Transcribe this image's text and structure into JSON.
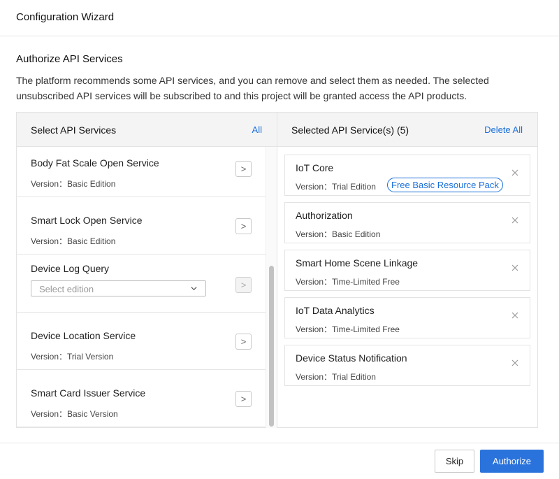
{
  "window": {
    "title": "Configuration Wizard"
  },
  "section": {
    "title": "Authorize API Services",
    "description": "The platform recommends some API services, and you can remove and select them as needed. The selected unsubscribed API services will be subscribed to and this project will be granted access the API products."
  },
  "left_panel": {
    "title": "Select API Services",
    "all_link": "All",
    "services": [
      {
        "name": "Body Fat Scale Open Service",
        "version": "Version：Basic Edition"
      },
      {
        "name": "Smart Lock Open Service",
        "version": "Version：Basic Edition"
      },
      {
        "name": "Device Log Query",
        "select_placeholder": "Select edition"
      },
      {
        "name": "Device Location Service",
        "version": "Version：Trial Version"
      },
      {
        "name": "Smart Card Issuer Service",
        "version": "Version：Basic Version"
      }
    ],
    "arrow_glyph": ">"
  },
  "right_panel": {
    "title": "Selected API Service(s) (5)",
    "delete_all": "Delete All",
    "items": [
      {
        "name": "IoT Core",
        "version": "Version：Trial Edition",
        "badge": "Free Basic Resource Pack"
      },
      {
        "name": "Authorization",
        "version": "Version：Basic Edition"
      },
      {
        "name": "Smart Home Scene Linkage",
        "version": "Version：Time-Limited Free"
      },
      {
        "name": "IoT Data Analytics",
        "version": "Version：Time-Limited Free"
      },
      {
        "name": "Device Status Notification",
        "version": "Version：Trial Edition"
      }
    ]
  },
  "footer": {
    "skip": "Skip",
    "authorize": "Authorize"
  },
  "colors": {
    "accent": "#1a6fdb",
    "primary_button": "#2b73dc",
    "panel_header_bg": "#f4f4f5",
    "border": "#e3e3e3"
  },
  "icons": {
    "arrow": "chevron-right-icon",
    "close": "close-icon",
    "dropdown": "chevron-down-icon"
  }
}
